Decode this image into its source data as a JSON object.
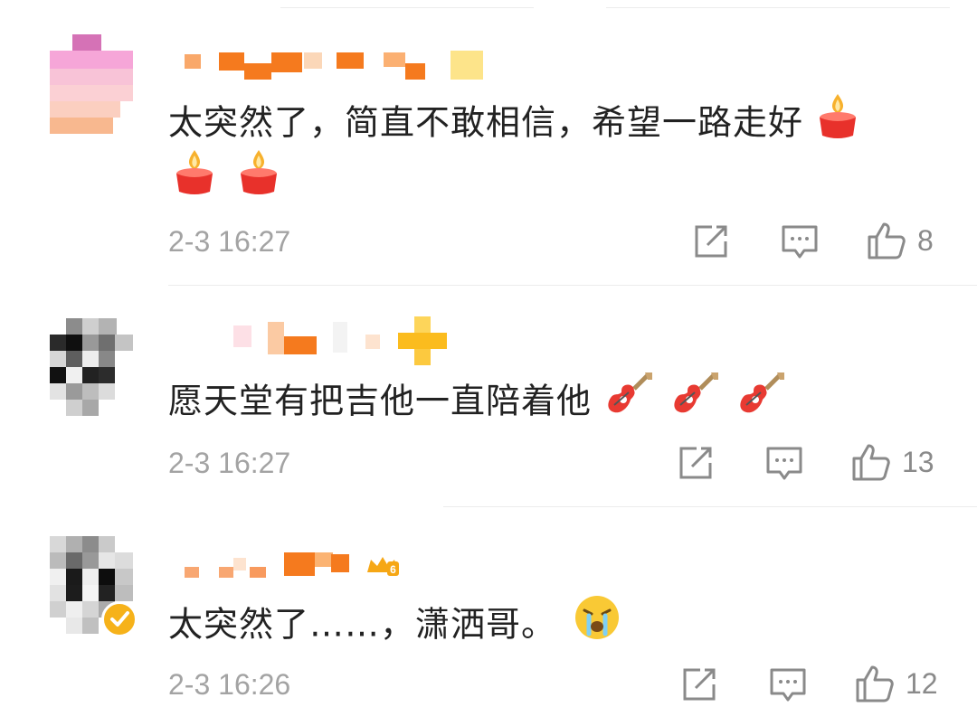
{
  "comments": [
    {
      "text": "太突然了，简直不敢相信，希望一路走好",
      "time": "2-3 16:27",
      "likes": "8",
      "emoji": "candle-icon"
    },
    {
      "text": "愿天堂有把吉他一直陪着他",
      "time": "2-3 16:27",
      "likes": "13",
      "emoji": "guitar-icon"
    },
    {
      "text": "太突然了……，潇洒哥。",
      "time": "2-3 16:26",
      "likes": "12",
      "emoji": "crying-face-icon"
    }
  ],
  "colors": {
    "text": "#222222",
    "meta": "#a3a3a3",
    "username_pixel": "#f57a1e",
    "verified": "#f6b21a"
  }
}
